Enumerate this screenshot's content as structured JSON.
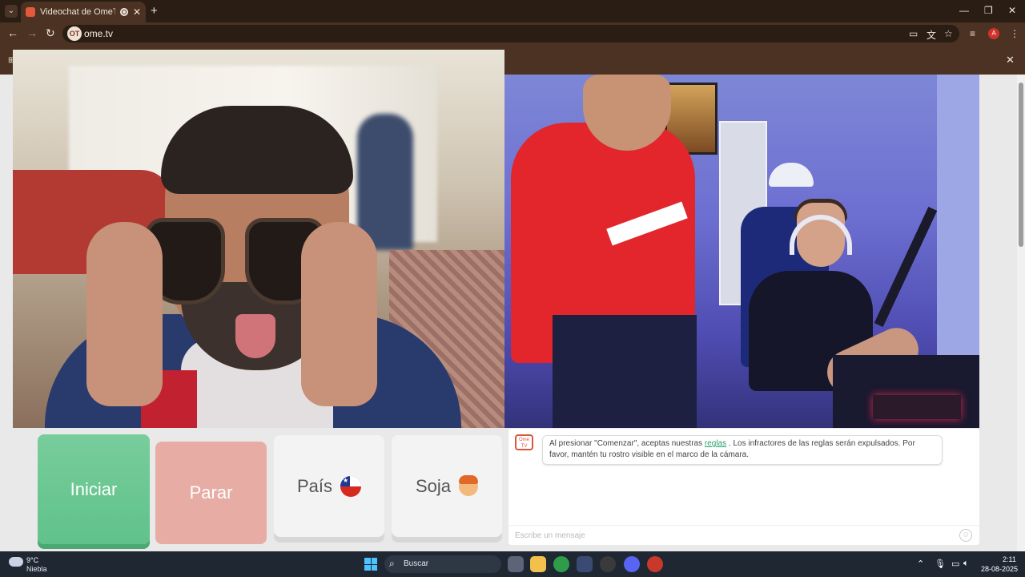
{
  "browser": {
    "tab_title": "Videochat de OmeTV: uno",
    "new_tab_symbol": "+",
    "url": "ome.tv",
    "site_icon_text": "OT",
    "profile_initial": "A",
    "window_controls": [
      "—",
      "❐",
      "✕"
    ]
  },
  "controls": {
    "start_label": "Iniciar",
    "stop_label": "Parar",
    "country_label": "País",
    "gender_label": "Soja",
    "country_flag": "chile-flag-icon",
    "gender_icon": "boy-emoji-icon"
  },
  "chat": {
    "logo_text": "Ome TV",
    "message_before_link": "Al presionar \"Comenzar\", aceptas nuestras ",
    "link_text": "reglas",
    "message_after_link": " . Los infractores de las reglas serán expulsados. Por favor, mantén tu rostro visible en el marco de la cámara.",
    "input_placeholder": "Escribe un mensaje"
  },
  "taskbar": {
    "temperature": "9°C",
    "condition": "Niebla",
    "search_placeholder": "Buscar",
    "time": "2:11",
    "date": "28-08-2025"
  },
  "colors": {
    "accent_green": "#60c28a",
    "stop_pink": "#e7ada4",
    "chrome_brown": "#4b3222"
  }
}
